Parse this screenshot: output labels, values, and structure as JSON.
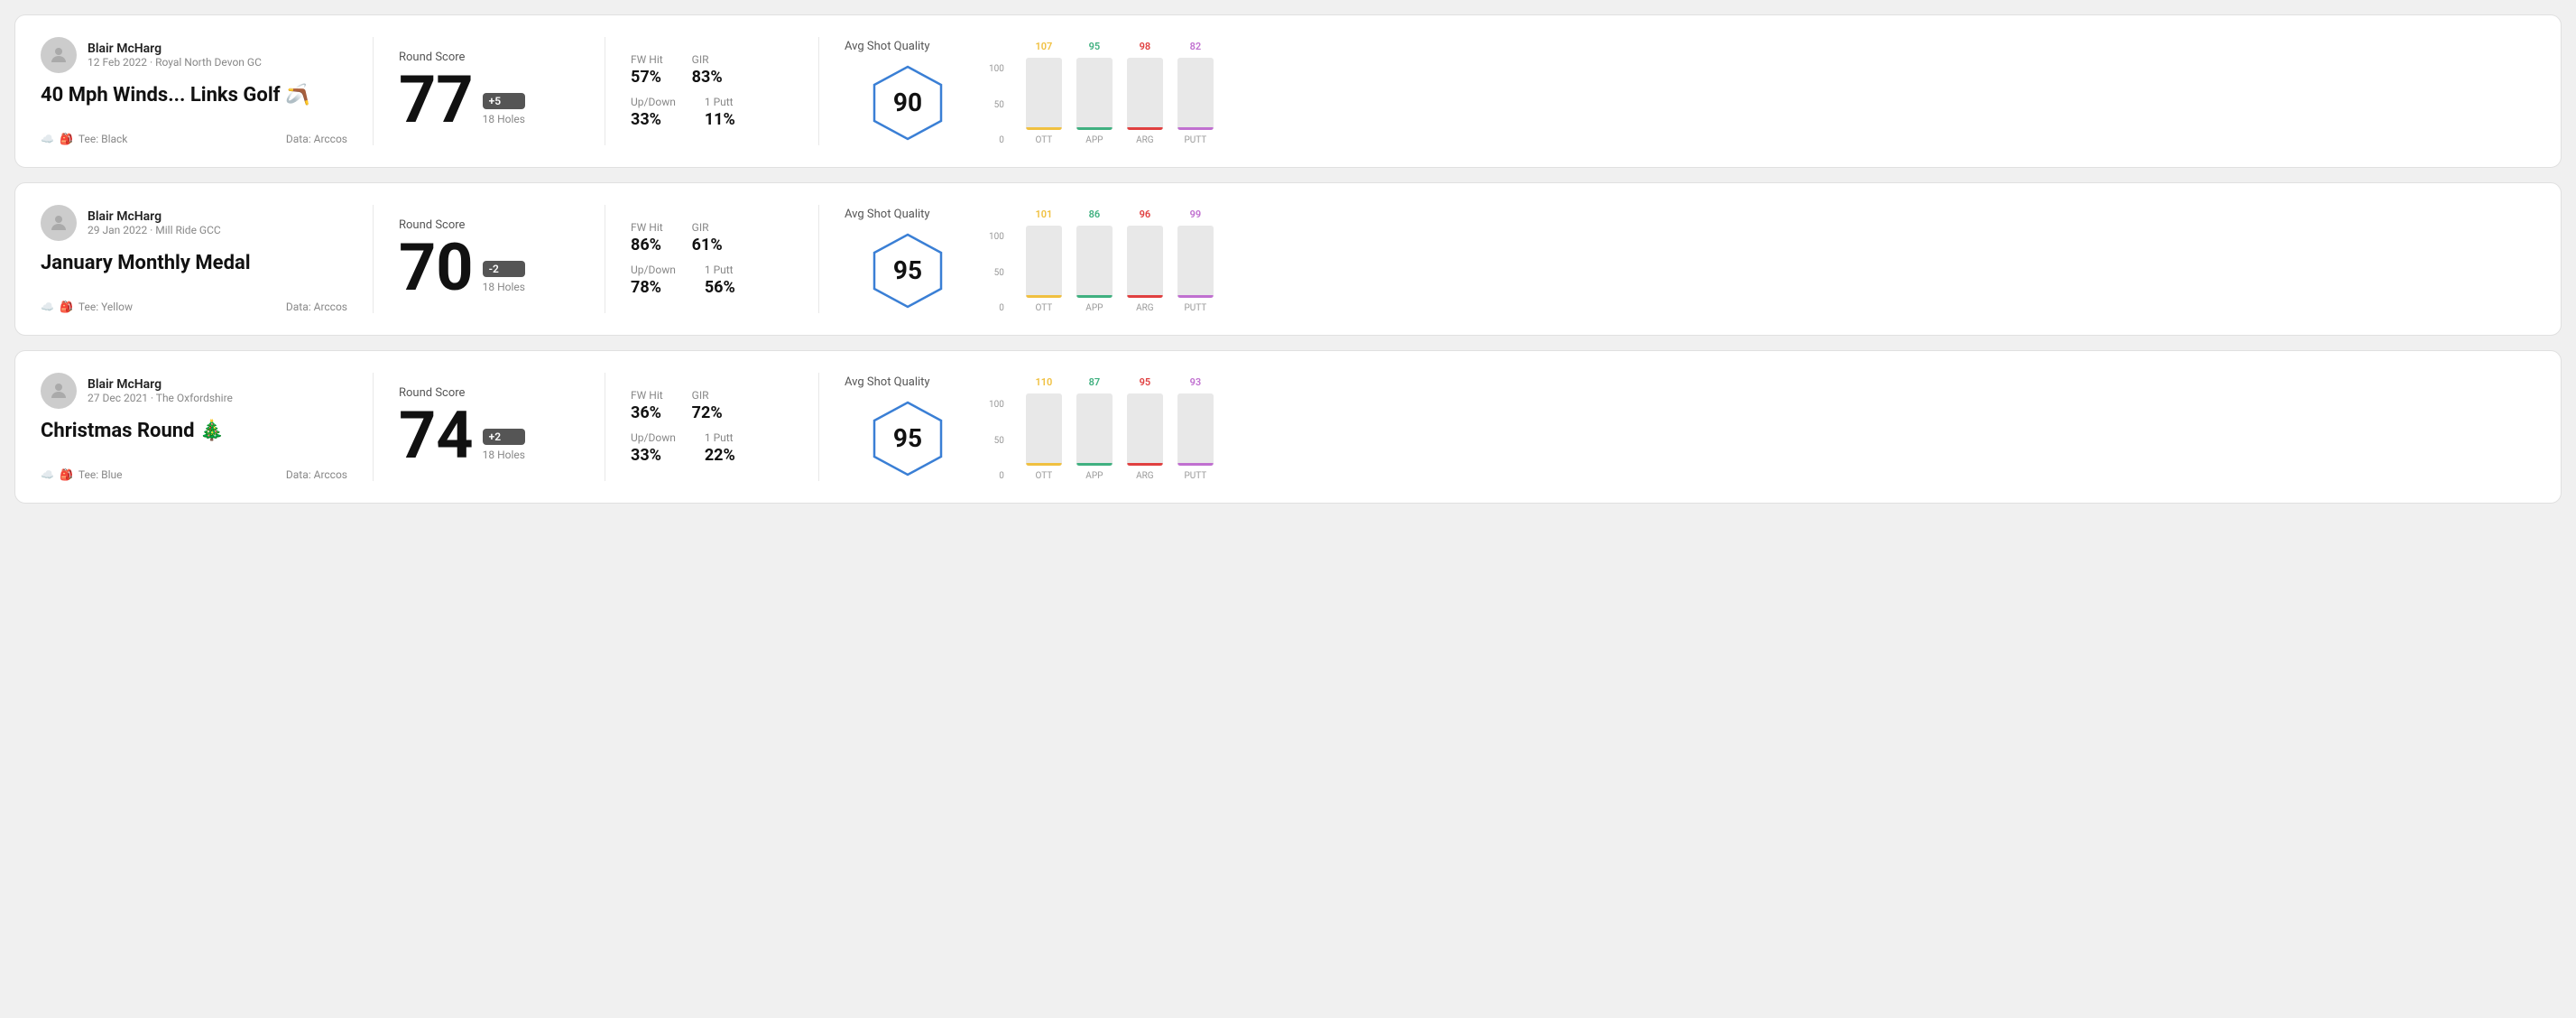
{
  "rounds": [
    {
      "id": "round1",
      "user_name": "Blair McHarg",
      "user_date": "12 Feb 2022 · Royal North Devon GC",
      "round_title": "40 Mph Winds... Links Golf 🪃",
      "tee_color": "Black",
      "data_source": "Data: Arccos",
      "round_score_label": "Round Score",
      "score": "77",
      "score_badge": "+5",
      "holes": "18 Holes",
      "fw_hit_label": "FW Hit",
      "fw_hit_value": "57%",
      "gir_label": "GIR",
      "gir_value": "83%",
      "updown_label": "Up/Down",
      "updown_value": "33%",
      "one_putt_label": "1 Putt",
      "one_putt_value": "11%",
      "avg_shot_quality_label": "Avg Shot Quality",
      "quality_score": "90",
      "chart_cols": [
        {
          "label": "OTT",
          "top_value": "107",
          "color": "#f0c040",
          "bar_pct": 72
        },
        {
          "label": "APP",
          "top_value": "95",
          "color": "#40b080",
          "bar_pct": 63
        },
        {
          "label": "ARG",
          "top_value": "98",
          "color": "#e04040",
          "bar_pct": 65
        },
        {
          "label": "PUTT",
          "top_value": "82",
          "color": "#c070d0",
          "bar_pct": 55
        }
      ]
    },
    {
      "id": "round2",
      "user_name": "Blair McHarg",
      "user_date": "29 Jan 2022 · Mill Ride GCC",
      "round_title": "January Monthly Medal",
      "tee_color": "Yellow",
      "data_source": "Data: Arccos",
      "round_score_label": "Round Score",
      "score": "70",
      "score_badge": "-2",
      "holes": "18 Holes",
      "fw_hit_label": "FW Hit",
      "fw_hit_value": "86%",
      "gir_label": "GIR",
      "gir_value": "61%",
      "updown_label": "Up/Down",
      "updown_value": "78%",
      "one_putt_label": "1 Putt",
      "one_putt_value": "56%",
      "avg_shot_quality_label": "Avg Shot Quality",
      "quality_score": "95",
      "chart_cols": [
        {
          "label": "OTT",
          "top_value": "101",
          "color": "#f0c040",
          "bar_pct": 68
        },
        {
          "label": "APP",
          "top_value": "86",
          "color": "#40b080",
          "bar_pct": 57
        },
        {
          "label": "ARG",
          "top_value": "96",
          "color": "#e04040",
          "bar_pct": 64
        },
        {
          "label": "PUTT",
          "top_value": "99",
          "color": "#c070d0",
          "bar_pct": 66
        }
      ]
    },
    {
      "id": "round3",
      "user_name": "Blair McHarg",
      "user_date": "27 Dec 2021 · The Oxfordshire",
      "round_title": "Christmas Round 🎄",
      "tee_color": "Blue",
      "data_source": "Data: Arccos",
      "round_score_label": "Round Score",
      "score": "74",
      "score_badge": "+2",
      "holes": "18 Holes",
      "fw_hit_label": "FW Hit",
      "fw_hit_value": "36%",
      "gir_label": "GIR",
      "gir_value": "72%",
      "updown_label": "Up/Down",
      "updown_value": "33%",
      "one_putt_label": "1 Putt",
      "one_putt_value": "22%",
      "avg_shot_quality_label": "Avg Shot Quality",
      "quality_score": "95",
      "chart_cols": [
        {
          "label": "OTT",
          "top_value": "110",
          "color": "#f0c040",
          "bar_pct": 73
        },
        {
          "label": "APP",
          "top_value": "87",
          "color": "#40b080",
          "bar_pct": 58
        },
        {
          "label": "ARG",
          "top_value": "95",
          "color": "#e04040",
          "bar_pct": 63
        },
        {
          "label": "PUTT",
          "top_value": "93",
          "color": "#c070d0",
          "bar_pct": 62
        }
      ]
    }
  ],
  "chart_y_labels": [
    "100",
    "50",
    "0"
  ]
}
